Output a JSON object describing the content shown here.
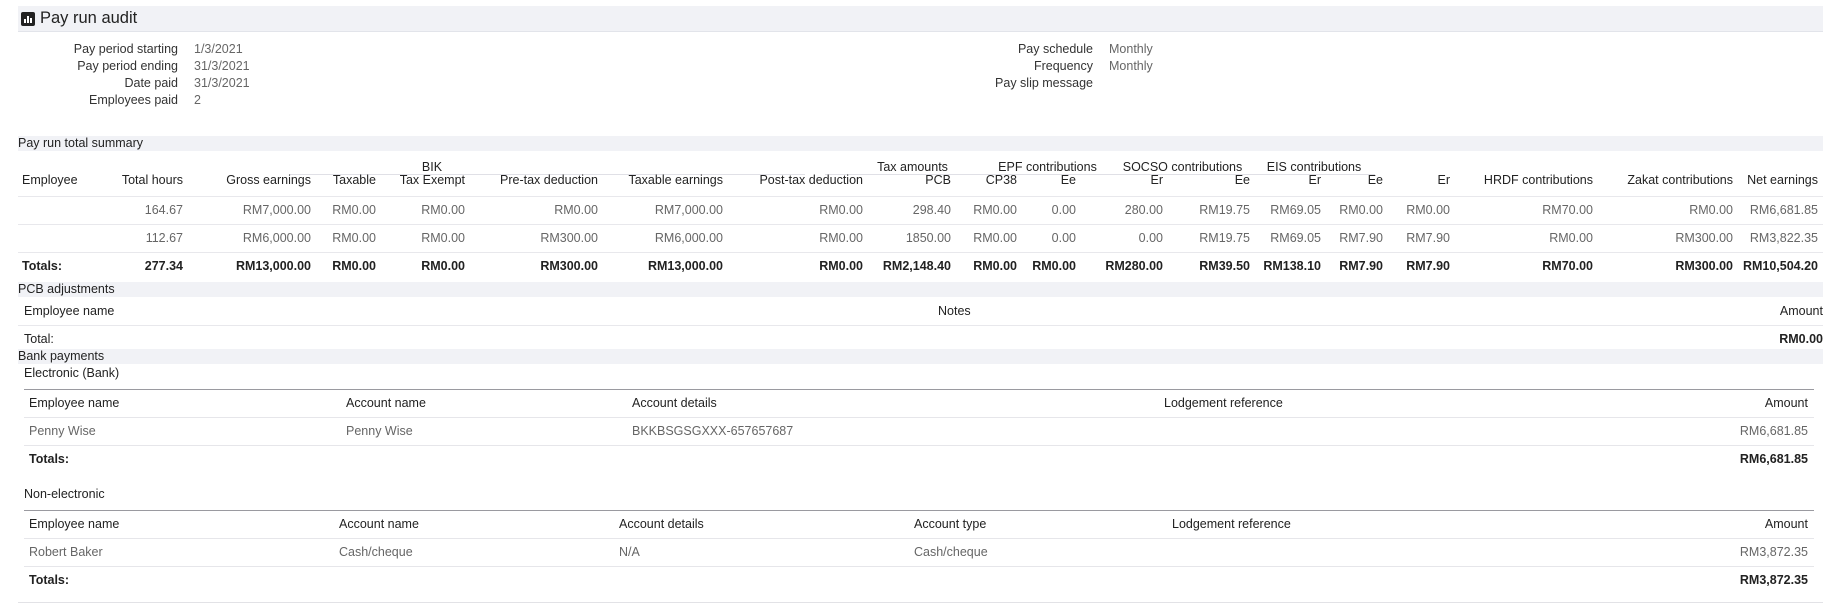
{
  "page": {
    "title": "Pay run audit",
    "icon": "chart-report-icon"
  },
  "meta_left": [
    {
      "label": "Pay period starting",
      "value": "1/3/2021"
    },
    {
      "label": "Pay period ending",
      "value": "31/3/2021"
    },
    {
      "label": "Date paid",
      "value": "31/3/2021"
    },
    {
      "label": "Employees paid",
      "value": "2"
    }
  ],
  "meta_right": [
    {
      "label": "Pay schedule",
      "value": "Monthly"
    },
    {
      "label": "Frequency",
      "value": "Monthly"
    },
    {
      "label": "Pay slip message",
      "value": ""
    }
  ],
  "summary": {
    "section_title": "Pay run total summary",
    "groups": {
      "bik": "BIK",
      "tax_amounts": "Tax amounts",
      "epf": "EPF contributions",
      "socso": "SOCSO contributions",
      "eis": "EIS contributions"
    },
    "headers": [
      "Employee",
      "Total hours",
      "Gross earnings",
      "Taxable",
      "Tax Exempt",
      "Pre-tax deduction",
      "Taxable earnings",
      "Post-tax deduction",
      "PCB",
      "CP38",
      "Ee",
      "Er",
      "Ee",
      "Er",
      "Ee",
      "Er",
      "HRDF contributions",
      "Zakat contributions",
      "Net earnings"
    ],
    "rows": [
      [
        "",
        "164.67",
        "RM7,000.00",
        "RM0.00",
        "RM0.00",
        "RM0.00",
        "RM7,000.00",
        "RM0.00",
        "298.40",
        "RM0.00",
        "0.00",
        "280.00",
        "RM19.75",
        "RM69.05",
        "RM0.00",
        "RM0.00",
        "RM70.00",
        "RM0.00",
        "RM6,681.85"
      ],
      [
        "",
        "112.67",
        "RM6,000.00",
        "RM0.00",
        "RM0.00",
        "RM300.00",
        "RM6,000.00",
        "RM0.00",
        "1850.00",
        "RM0.00",
        "0.00",
        "0.00",
        "RM19.75",
        "RM69.05",
        "RM7.90",
        "RM7.90",
        "RM0.00",
        "RM300.00",
        "RM3,822.35"
      ]
    ],
    "totals": [
      "Totals:",
      "277.34",
      "RM13,000.00",
      "RM0.00",
      "RM0.00",
      "RM300.00",
      "RM13,000.00",
      "RM0.00",
      "RM2,148.40",
      "RM0.00",
      "RM0.00",
      "RM280.00",
      "RM39.50",
      "RM138.10",
      "RM7.90",
      "RM7.90",
      "RM70.00",
      "RM300.00",
      "RM10,504.20"
    ]
  },
  "pcb": {
    "section_title": "PCB adjustments",
    "headers": {
      "employee_name": "Employee name",
      "notes": "Notes",
      "amount": "Amount"
    },
    "total_label": "Total:",
    "total_value": "RM0.00"
  },
  "bank": {
    "section_title": "Bank payments",
    "electronic": {
      "title": "Electronic (Bank)",
      "headers": {
        "employee_name": "Employee name",
        "account_name": "Account name",
        "account_details": "Account details",
        "lodgement": "Lodgement reference",
        "amount": "Amount"
      },
      "rows": [
        {
          "employee_name": "Penny Wise",
          "account_name": "Penny Wise",
          "account_details": "BKKBSGSGXXX-657657687",
          "lodgement": "",
          "amount": "RM6,681.85"
        }
      ],
      "total_label": "Totals:",
      "total_value": "RM6,681.85"
    },
    "non_electronic": {
      "title": "Non-electronic",
      "headers": {
        "employee_name": "Employee name",
        "account_name": "Account name",
        "account_details": "Account details",
        "account_type": "Account type",
        "lodgement": "Lodgement reference",
        "amount": "Amount"
      },
      "rows": [
        {
          "employee_name": "Robert Baker",
          "account_name": "Cash/cheque",
          "account_details": "N/A",
          "account_type": "Cash/cheque",
          "lodgement": "",
          "amount": "RM3,872.35"
        }
      ],
      "total_label": "Totals:",
      "total_value": "RM3,872.35"
    }
  }
}
